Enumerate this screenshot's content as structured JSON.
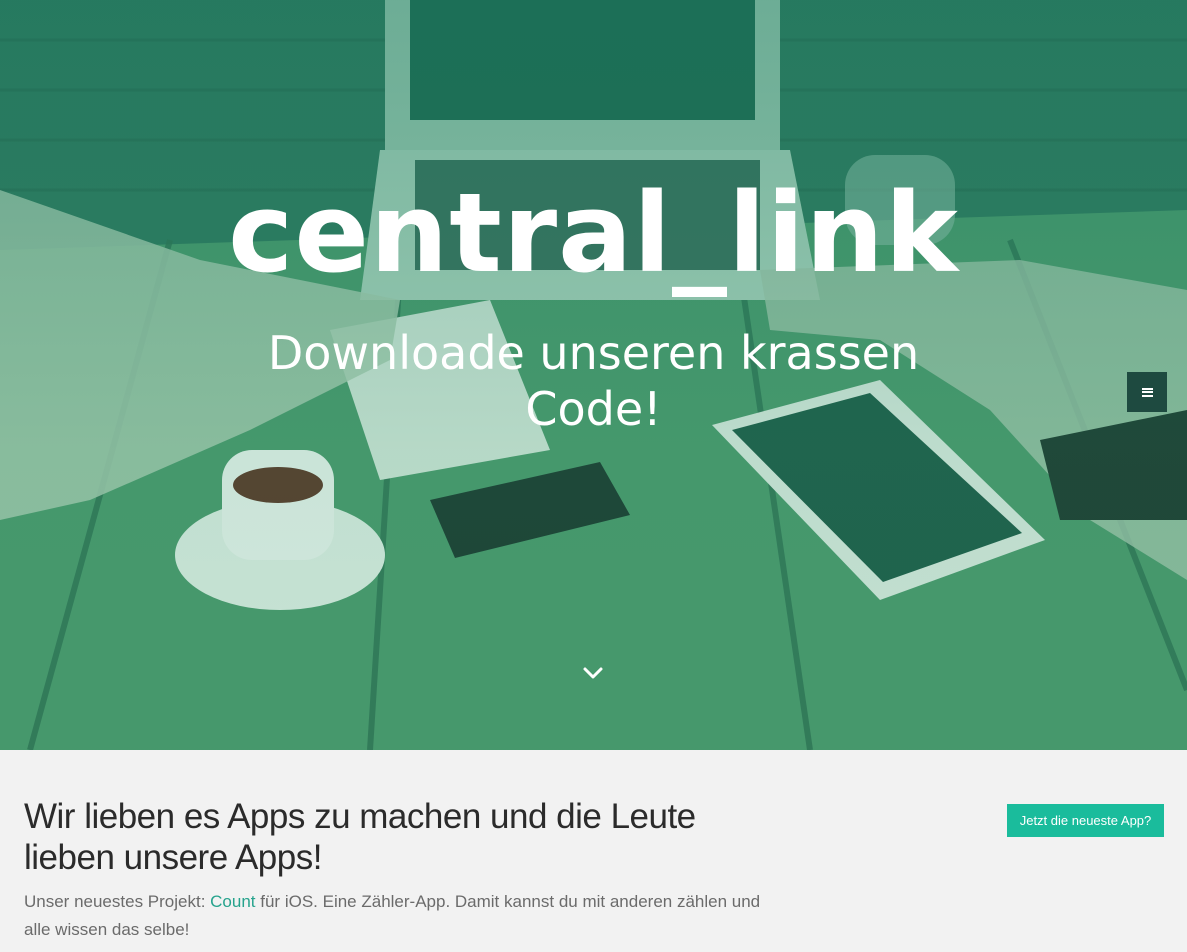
{
  "hero": {
    "title": "central_link",
    "subtitle": "Downloade unseren krassen Code!",
    "menu_icon": "hamburger-icon",
    "scroll_icon": "chevron-down-icon"
  },
  "intro": {
    "heading": "Wir lieben es Apps zu machen und die Leute lieben unsere Apps!",
    "text_before_link": "Unser neuestes Projekt: ",
    "link_label": "Count",
    "text_after_link": " für iOS. Eine Zähler-App. Damit kannst du mit anderen zählen und alle wissen das selbe!",
    "cta_label": "Jetzt die neueste App?"
  },
  "colors": {
    "accent": "#1abc9c",
    "link": "#26a38d",
    "menu_bg": "#1e4a40",
    "hero_tint": "#3e8a68"
  }
}
